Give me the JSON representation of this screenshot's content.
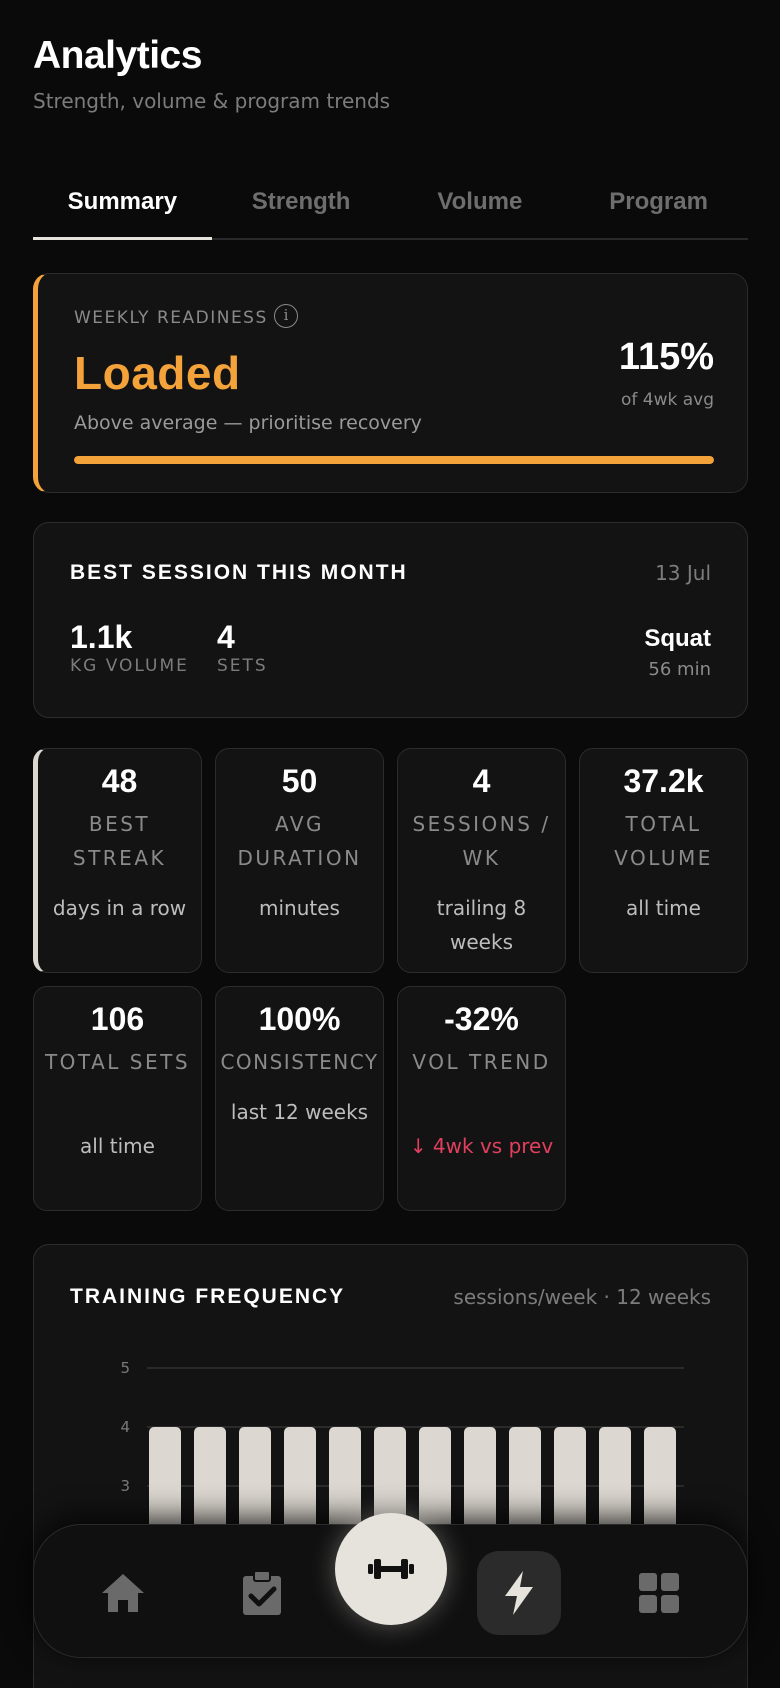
{
  "header": {
    "title": "Analytics",
    "subtitle": "Strength, volume & program trends"
  },
  "tabs": [
    {
      "label": "Summary",
      "active": true
    },
    {
      "label": "Strength",
      "active": false
    },
    {
      "label": "Volume",
      "active": false
    },
    {
      "label": "Program",
      "active": false
    }
  ],
  "readiness": {
    "label": "WEEKLY READINESS",
    "info_icon": "info-icon",
    "status": "Loaded",
    "note": "Above average — prioritise recovery",
    "percent": "115%",
    "percent_caption": "of 4wk avg",
    "bar_fraction": 1.0,
    "color": "#f4a23a"
  },
  "best_session": {
    "title": "BEST SESSION THIS MONTH",
    "date": "13 Jul",
    "volume_value": "1.1k",
    "volume_label": "KG VOLUME",
    "sets_value": "4",
    "sets_label": "SETS",
    "exercise": "Squat",
    "duration": "56 min"
  },
  "stats": [
    {
      "value": "48",
      "label": "BEST STREAK",
      "sub": "days in a row"
    },
    {
      "value": "50",
      "label": "AVG DURATION",
      "sub": "minutes"
    },
    {
      "value": "4",
      "label": "SESSIONS / WK",
      "sub": "trailing 8 weeks"
    },
    {
      "value": "37.2k",
      "label": "TOTAL VOLUME",
      "sub": "all time"
    },
    {
      "value": "106",
      "label": "TOTAL SETS",
      "sub": "all time"
    },
    {
      "value": "100%",
      "label": "CONSISTENCY",
      "sub": "last 12 weeks"
    },
    {
      "value": "-32%",
      "label": "VOL TREND",
      "sub": "↓ 4wk vs prev"
    }
  ],
  "frequency": {
    "title": "TRAINING FREQUENCY",
    "meta": "sessions/week · 12 weeks"
  },
  "chart_data": {
    "type": "bar",
    "title": "TRAINING FREQUENCY",
    "subtitle": "sessions/week · 12 weeks",
    "categories": [
      "",
      "",
      "",
      "",
      "",
      "",
      "",
      "",
      "",
      "",
      "",
      ""
    ],
    "values": [
      4,
      4,
      4,
      4,
      4,
      4,
      4,
      4,
      4,
      4,
      4,
      4
    ],
    "y_ticks": [
      5,
      4,
      3
    ],
    "ylim": [
      0,
      5
    ],
    "grid": true,
    "bar_color": "#dcd7d0"
  },
  "nav": {
    "items": [
      "home-icon",
      "clipboard-check-icon",
      "dumbbell-icon",
      "bolt-icon",
      "grid-icon"
    ]
  },
  "colors": {
    "accent": "#f4a23a",
    "negative": "#e0405e",
    "background": "#0a0a0a",
    "card": "#131313"
  }
}
